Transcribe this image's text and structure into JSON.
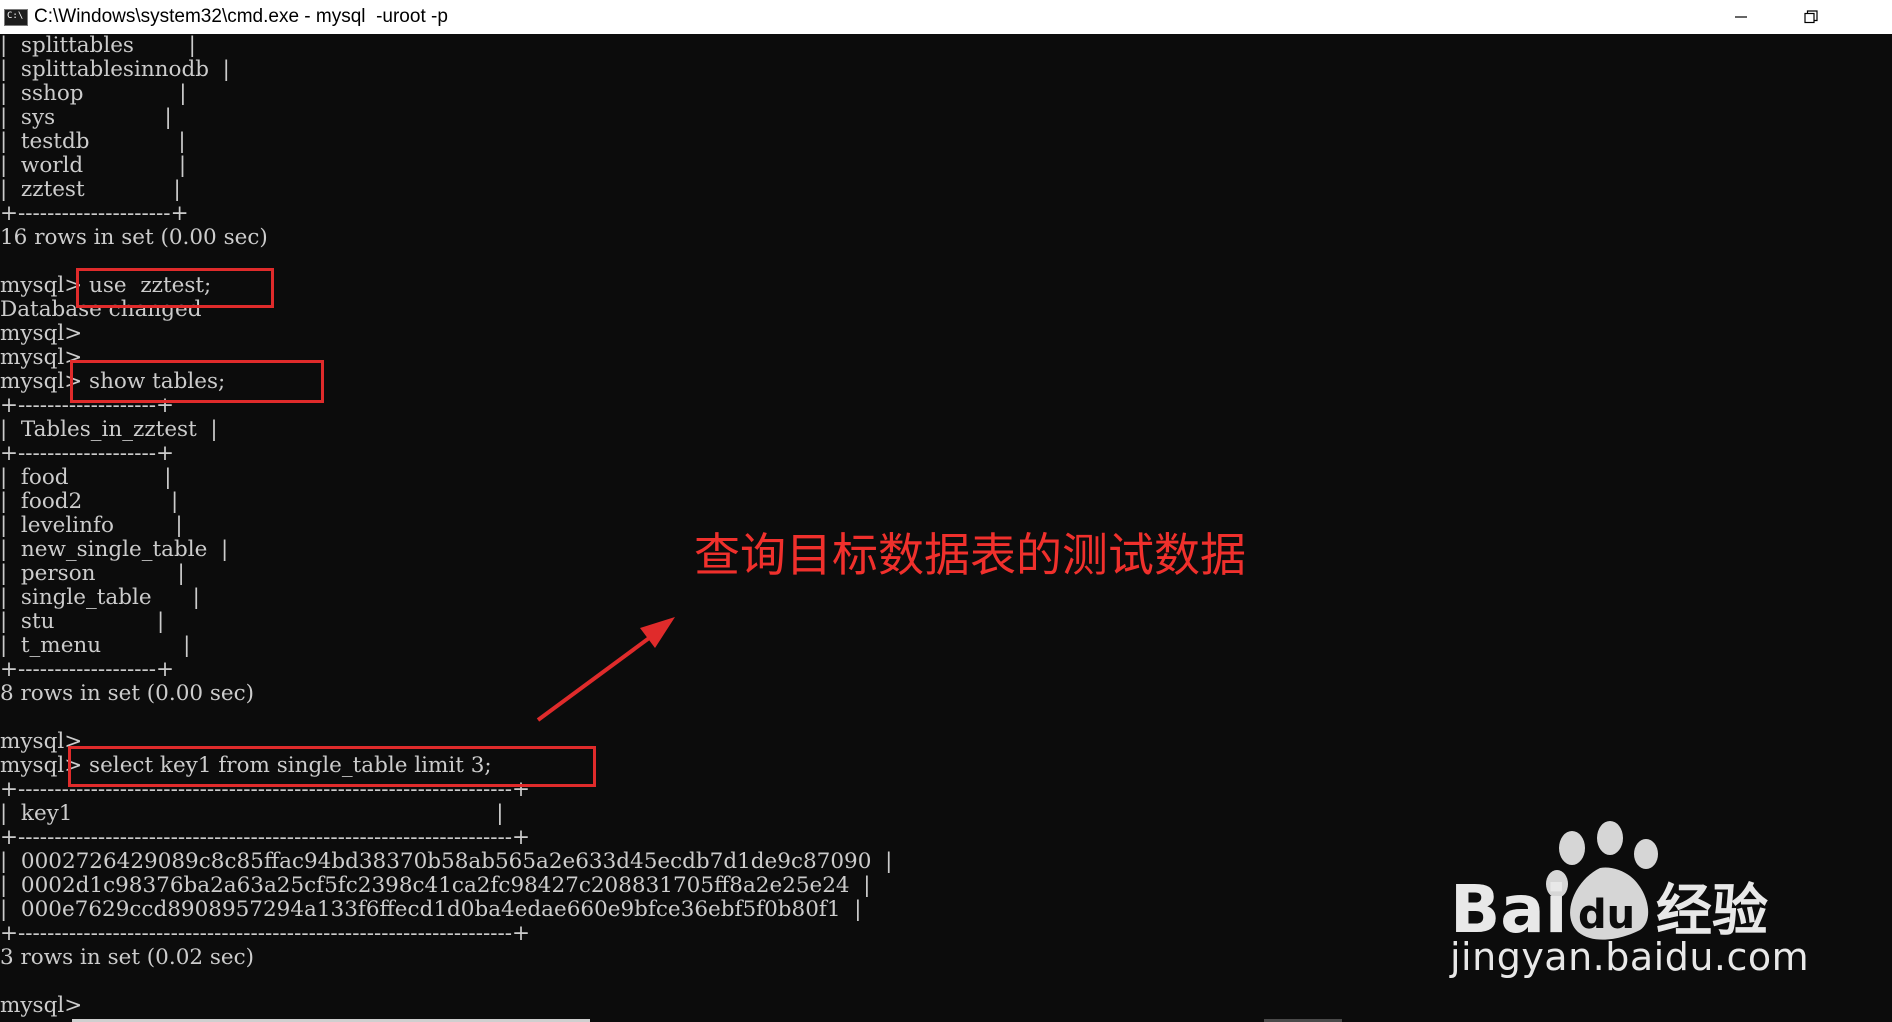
{
  "window": {
    "icon_text": "C:\\",
    "title": "C:\\Windows\\system32\\cmd.exe - mysql  -uroot -p"
  },
  "console": {
    "lines": [
      "|  splittables        |",
      "|  splittablesinnodb  |",
      "|  sshop              |",
      "|  sys                |",
      "|  testdb             |",
      "|  world              |",
      "|  zztest             |",
      "+---------------------+",
      "16 rows in set (0.00 sec)",
      "",
      "mysql> use  zztest;",
      "Database changed",
      "mysql>",
      "mysql>",
      "mysql> show tables;",
      "+-------------------+",
      "|  Tables_in_zztest  |",
      "+-------------------+",
      "|  food              |",
      "|  food2             |",
      "|  levelinfo         |",
      "|  new_single_table  |",
      "|  person            |",
      "|  single_table      |",
      "|  stu               |",
      "|  t_menu            |",
      "+-------------------+",
      "8 rows in set (0.00 sec)",
      "",
      "mysql>",
      "mysql> select key1 from single_table limit 3;",
      "+--------------------------------------------------------------------+",
      "|  key1                                                              |",
      "+--------------------------------------------------------------------+",
      "|  0002726429089c8c85ffac94bd38370b58ab565a2e633d45ecdb7d1de9c87090  |",
      "|  0002d1c98376ba2a63a25cf5fc2398c41ca2fc98427c208831705ff8a2e25e24  |",
      "|  000e7629ccd8908957294a133f6ffecd1d0ba4edae660e9bfce36ebf5f0b80f1  |",
      "+--------------------------------------------------------------------+",
      "3 rows in set (0.02 sec)",
      "",
      "mysql>"
    ]
  },
  "annotation": {
    "text": "查询目标数据表的测试数据",
    "color": "#f0302c"
  },
  "watermark": {
    "brand": "Bai",
    "brand_du": "du",
    "brand_cn": "经验",
    "url": "jingyan.baidu.com"
  },
  "colors": {
    "console_bg": "#0c0c0c",
    "console_fg": "#cccccc",
    "highlight": "#e02b2b"
  }
}
